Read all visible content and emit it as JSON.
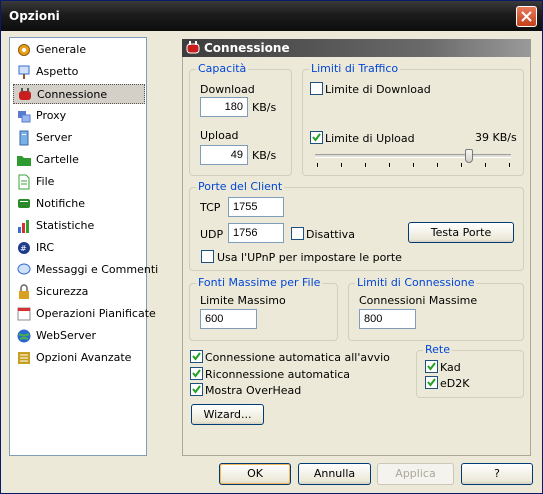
{
  "window": {
    "title": "Opzioni"
  },
  "sidebar": {
    "items": [
      {
        "label": "Generale",
        "icon": "gear-icon",
        "color": "#e8a020"
      },
      {
        "label": "Aspetto",
        "icon": "paintbrush-icon",
        "color": "#3a6fcf"
      },
      {
        "label": "Connessione",
        "icon": "plug-icon",
        "color": "#c81e1e"
      },
      {
        "label": "Proxy",
        "icon": "proxy-icon",
        "color": "#5a7ad0"
      },
      {
        "label": "Server",
        "icon": "server-icon",
        "color": "#7ab0e8"
      },
      {
        "label": "Cartelle",
        "icon": "folder-icon",
        "color": "#2f9a2f"
      },
      {
        "label": "File",
        "icon": "file-icon",
        "color": "#3aa03a"
      },
      {
        "label": "Notifiche",
        "icon": "notification-icon",
        "color": "#2a8a2a"
      },
      {
        "label": "Statistiche",
        "icon": "chart-icon",
        "color": "#3a6fcf"
      },
      {
        "label": "IRC",
        "icon": "irc-icon",
        "color": "#1e3a8a"
      },
      {
        "label": "Messaggi e Commenti",
        "icon": "messages-icon",
        "color": "#3a6fcf"
      },
      {
        "label": "Sicurezza",
        "icon": "lock-icon",
        "color": "#d8a020"
      },
      {
        "label": "Operazioni Pianificate",
        "icon": "calendar-icon",
        "color": "#8a8a8a"
      },
      {
        "label": "WebServer",
        "icon": "globe-icon",
        "color": "#2a6acf"
      },
      {
        "label": "Opzioni Avanzate",
        "icon": "advanced-icon",
        "color": "#c8a020"
      }
    ],
    "selected": "Connessione"
  },
  "panel": {
    "title": "Connessione",
    "capacita": {
      "title": "Capacità",
      "download_label": "Download",
      "download_value": "180",
      "download_unit": "KB/s",
      "upload_label": "Upload",
      "upload_value": "49",
      "upload_unit": "KB/s"
    },
    "limiti_traffico": {
      "title": "Limiti di Traffico",
      "download_limit_label": "Limite di Download",
      "download_limit_checked": false,
      "upload_limit_label": "Limite di Upload",
      "upload_limit_checked": true,
      "upload_limit_value": "39 KB/s",
      "upload_slider_fraction": 0.8
    },
    "porte": {
      "title": "Porte del Client",
      "tcp_label": "TCP",
      "tcp_value": "1755",
      "udp_label": "UDP",
      "udp_value": "1756",
      "disattiva_label": "Disattiva",
      "disattiva_checked": false,
      "test_button": "Testa Porte",
      "upnp_label": "Usa l'UPnP per impostare le porte",
      "upnp_checked": false
    },
    "fonti": {
      "title": "Fonti Massime per File",
      "label": "Limite Massimo",
      "value": "600"
    },
    "limiti_connessione": {
      "title": "Limiti di Connessione",
      "label": "Connessioni Massime",
      "value": "800"
    },
    "options": [
      {
        "label": "Connessione automatica all'avvio",
        "checked": true
      },
      {
        "label": "Riconnessione automatica",
        "checked": true
      },
      {
        "label": "Mostra OverHead",
        "checked": true
      }
    ],
    "rete": {
      "title": "Rete",
      "kad_label": "Kad",
      "kad_checked": true,
      "ed2k_label": "eD2K",
      "ed2k_checked": true
    },
    "wizard_button": "Wizard..."
  },
  "footer": {
    "ok": "OK",
    "annulla": "Annulla",
    "applica": "Applica",
    "help": "?"
  }
}
